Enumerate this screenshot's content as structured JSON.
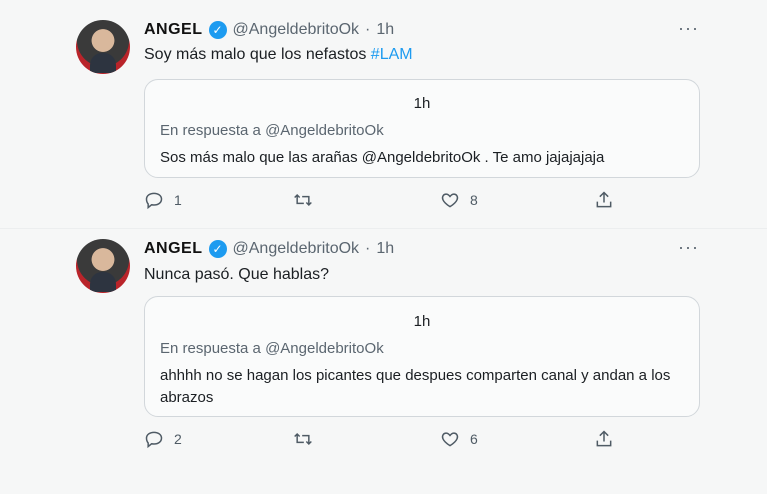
{
  "tweets": [
    {
      "author_name": "ANGEL",
      "handle": "@AngeldebritoOk",
      "separator": "·",
      "time": "1h",
      "text": "Soy más malo que los nefastos",
      "hashtag": "#LAM",
      "quoted": {
        "time": "1h",
        "reply_to": "En respuesta a @AngeldebritoOk",
        "text": "Sos más malo que las arañas @AngeldebritoOk . Te amo jajajajaja"
      },
      "replies": "1",
      "retweets": "",
      "likes": "8"
    },
    {
      "author_name": "ANGEL",
      "handle": "@AngeldebritoOk",
      "separator": "·",
      "time": "1h",
      "text": "Nunca pasó. Que hablas?",
      "hashtag": "",
      "quoted": {
        "time": "1h",
        "reply_to": "En respuesta a @AngeldebritoOk",
        "text": "ahhhh no se hagan los picantes que despues comparten canal y andan a los abrazos"
      },
      "replies": "2",
      "retweets": "",
      "likes": "6"
    }
  ],
  "icons": {
    "verified": "verified-badge-icon",
    "more": "more-options-icon",
    "reply": "reply-icon",
    "retweet": "retweet-icon",
    "like": "heart-icon",
    "share": "share-icon"
  },
  "colors": {
    "accent": "#1d9bf0",
    "secondary_text": "#5b6670",
    "border": "#d2d7db"
  }
}
